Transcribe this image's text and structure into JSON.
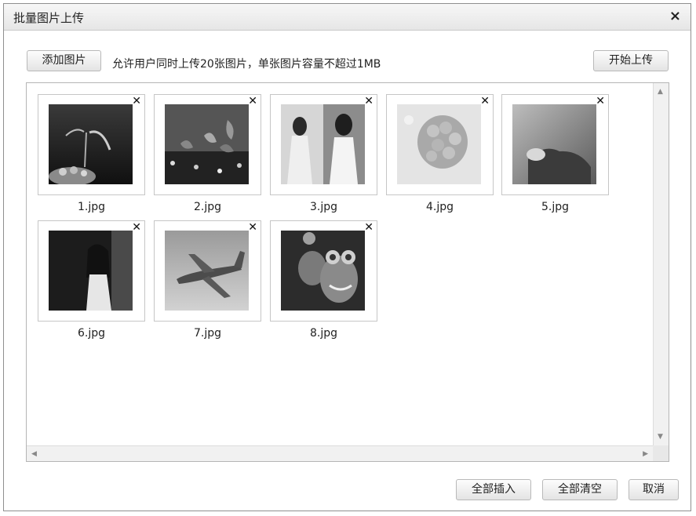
{
  "dialog": {
    "title": "批量图片上传",
    "close_icon": "×"
  },
  "toolbar": {
    "add_label": "添加图片",
    "hint": "允许用户同时上传20张图片，单张图片容量不超过1MB",
    "start_label": "开始上传"
  },
  "images": [
    {
      "name": "1.jpg",
      "delete": "✕"
    },
    {
      "name": "2.jpg",
      "delete": "✕"
    },
    {
      "name": "3.jpg",
      "delete": "✕"
    },
    {
      "name": "4.jpg",
      "delete": "✕"
    },
    {
      "name": "5.jpg",
      "delete": "✕"
    },
    {
      "name": "6.jpg",
      "delete": "✕"
    },
    {
      "name": "7.jpg",
      "delete": "✕"
    },
    {
      "name": "8.jpg",
      "delete": "✕"
    }
  ],
  "scroll": {
    "up": "▲",
    "down": "▼",
    "left": "◀",
    "right": "▶"
  },
  "footer": {
    "insert_all_label": "全部插入",
    "clear_all_label": "全部清空",
    "cancel_label": "取消"
  }
}
